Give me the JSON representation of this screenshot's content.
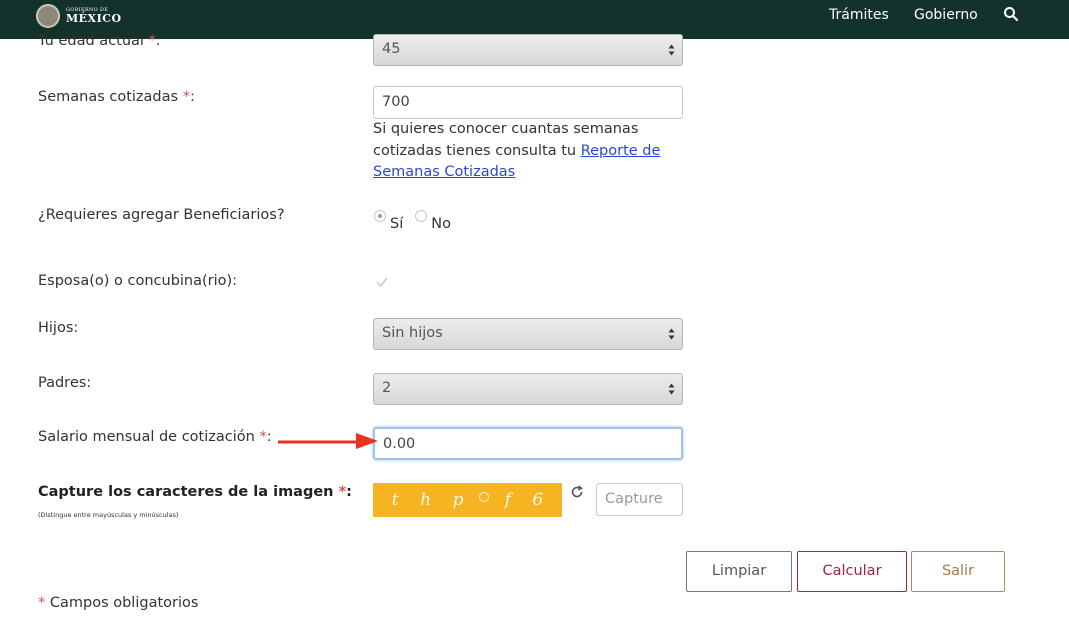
{
  "header": {
    "logo_small": "GOBIERNO DE",
    "logo_big": "MÉXICO",
    "nav": [
      "Trámites",
      "Gobierno"
    ],
    "search_icon": "search-icon",
    "bg_color": "#12322b"
  },
  "form": {
    "age": {
      "label": "Tu edad actual",
      "value": "45"
    },
    "weeks": {
      "label": "Semanas cotizadas",
      "value": "700",
      "help_text": "Si quieres conocer cuantas semanas cotizadas tienes consulta tu ",
      "help_link": "Reporte de Semanas Cotizadas"
    },
    "beneficiaries": {
      "label": "¿Requieres agregar Beneficiarios?",
      "options": [
        "Sí",
        "No"
      ],
      "selected": "Sí"
    },
    "spouse": {
      "label": "Esposa(o) o concubina(rio):",
      "checked": true
    },
    "children": {
      "label": "Hijos:",
      "value": "Sin hijos"
    },
    "parents": {
      "label": "Padres:",
      "value": "2"
    },
    "salary": {
      "label": "Salario mensual de cotización",
      "value": "0.00"
    },
    "captcha": {
      "label": "Capture los caracteres de la imagen",
      "note": "(Distingue entre mayúsculas y minúsculas)",
      "image_chars": [
        "t",
        "h",
        "p",
        "f",
        "6"
      ],
      "placeholder": "Capture",
      "image_color": "#f6b423"
    },
    "required_mark": "*",
    "label_suffix": ":"
  },
  "buttons": {
    "clear": "Limpiar",
    "calculate": "Calcular",
    "exit": "Salir"
  },
  "footnote": {
    "mark": "*",
    "text": " Campos obligatorios"
  },
  "colors": {
    "calculate_border": "#9d2449",
    "exit_border": "#b38e5d",
    "required": "#d9534f",
    "annotation_arrow": "#e8311f"
  }
}
